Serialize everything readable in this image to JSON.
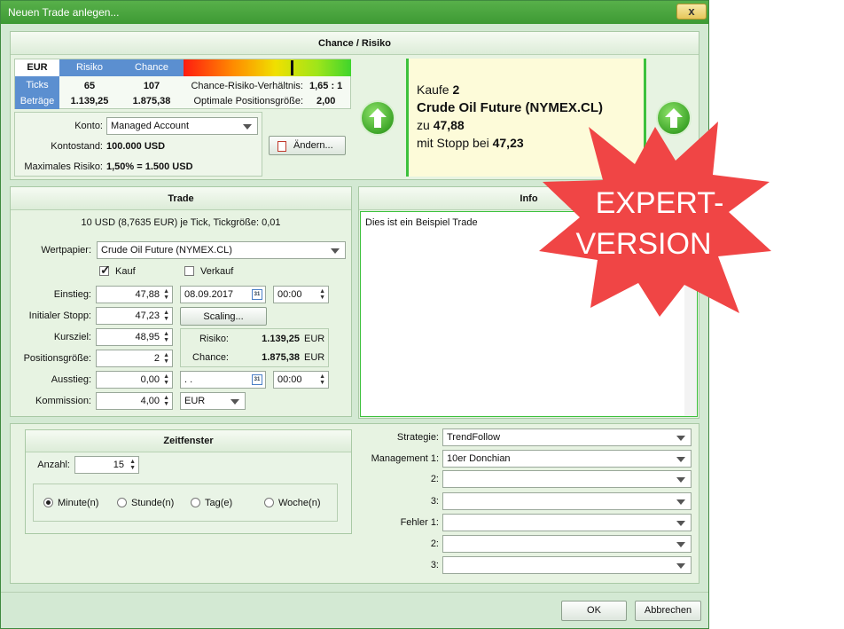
{
  "window": {
    "title": "Neuen Trade anlegen...",
    "close_label": "x"
  },
  "chance_risiko": {
    "title": "Chance / Risiko",
    "cols": {
      "currency": "EUR",
      "risiko": "Risiko",
      "chance": "Chance"
    },
    "rows": {
      "ticks_label": "Ticks",
      "betraege_label": "Beträge"
    },
    "ticks": {
      "risiko": "65",
      "chance": "107"
    },
    "betraege": {
      "risiko": "1.139,25",
      "chance": "1.875,38"
    },
    "crv_label": "Chance-Risiko-Verhältnis:",
    "crv_value": "1,65 : 1",
    "opt_label": "Optimale Positionsgröße:",
    "opt_value": "2,00",
    "gradient_marker_fraction": 0.64
  },
  "account": {
    "konto_label": "Konto:",
    "konto_value": "Managed Account",
    "kontostand_label": "Kontostand:",
    "kontostand_value": "100.000 USD",
    "max_risiko_label": "Maximales Risiko:",
    "max_risiko_value": "1,50% = 1.500 USD",
    "aendern_label": "Ändern..."
  },
  "order_summary": {
    "line1_prefix": "Kaufe",
    "line1_qty": "2",
    "instrument": "Crude Oil Future (NYMEX.CL)",
    "line3_prefix": "zu",
    "line3_price": "47,88",
    "line4_prefix": "mit Stopp bei",
    "line4_price": "47,23"
  },
  "trade": {
    "title": "Trade",
    "tick_info": "10 USD (8,7635 EUR) je Tick, Tickgröße: 0,01",
    "wertpapier_label": "Wertpapier:",
    "wertpapier_value": "Crude Oil Future (NYMEX.CL)",
    "kauf_label": "Kauf",
    "verkauf_label": "Verkauf",
    "einstieg_label": "Einstieg:",
    "einstieg_value": "47,88",
    "einstieg_date": "08.09.2017",
    "einstieg_time": "00:00",
    "stopp_label": "Initialer Stopp:",
    "stopp_value": "47,23",
    "scaling_label": "Scaling...",
    "kursziel_label": "Kursziel:",
    "kursziel_value": "48,95",
    "pos_label": "Positionsgröße:",
    "pos_value": "2",
    "risiko_label": "Risiko:",
    "risiko_value": "1.139,25",
    "risiko_unit": "EUR",
    "chance_label": "Chance:",
    "chance_value": "1.875,38",
    "chance_unit": "EUR",
    "ausstieg_label": "Ausstieg:",
    "ausstieg_value": "0,00",
    "ausstieg_date": " .  .",
    "ausstieg_time": "00:00",
    "kommission_label": "Kommission:",
    "kommission_value": "4,00",
    "kommission_currency": "EUR"
  },
  "info": {
    "title": "Info",
    "text": "Dies ist ein Beispiel Trade"
  },
  "zeitfenster": {
    "title": "Zeitfenster",
    "anzahl_label": "Anzahl:",
    "anzahl_value": "15",
    "options": [
      "Minute(n)",
      "Stunde(n)",
      "Tag(e)",
      "Woche(n)"
    ],
    "selected": "Minute(n)"
  },
  "strategy": {
    "strategie_label": "Strategie:",
    "strategie_value": "TrendFollow",
    "management1_label": "Management 1:",
    "management1_value": "10er Donchian",
    "management2_label": "2:",
    "management3_label": "3:",
    "fehler1_label": "Fehler 1:",
    "fehler2_label": "2:",
    "fehler3_label": "3:"
  },
  "footer": {
    "ok_label": "OK",
    "cancel_label": "Abbrechen"
  },
  "badge": {
    "line1": "EXPERT-",
    "line2": "VERSION"
  },
  "colors": {
    "title_bar": "#3d9a34",
    "header_blue": "#5b8fd0",
    "badge_red": "#f04545",
    "order_border": "#3cc13c"
  }
}
